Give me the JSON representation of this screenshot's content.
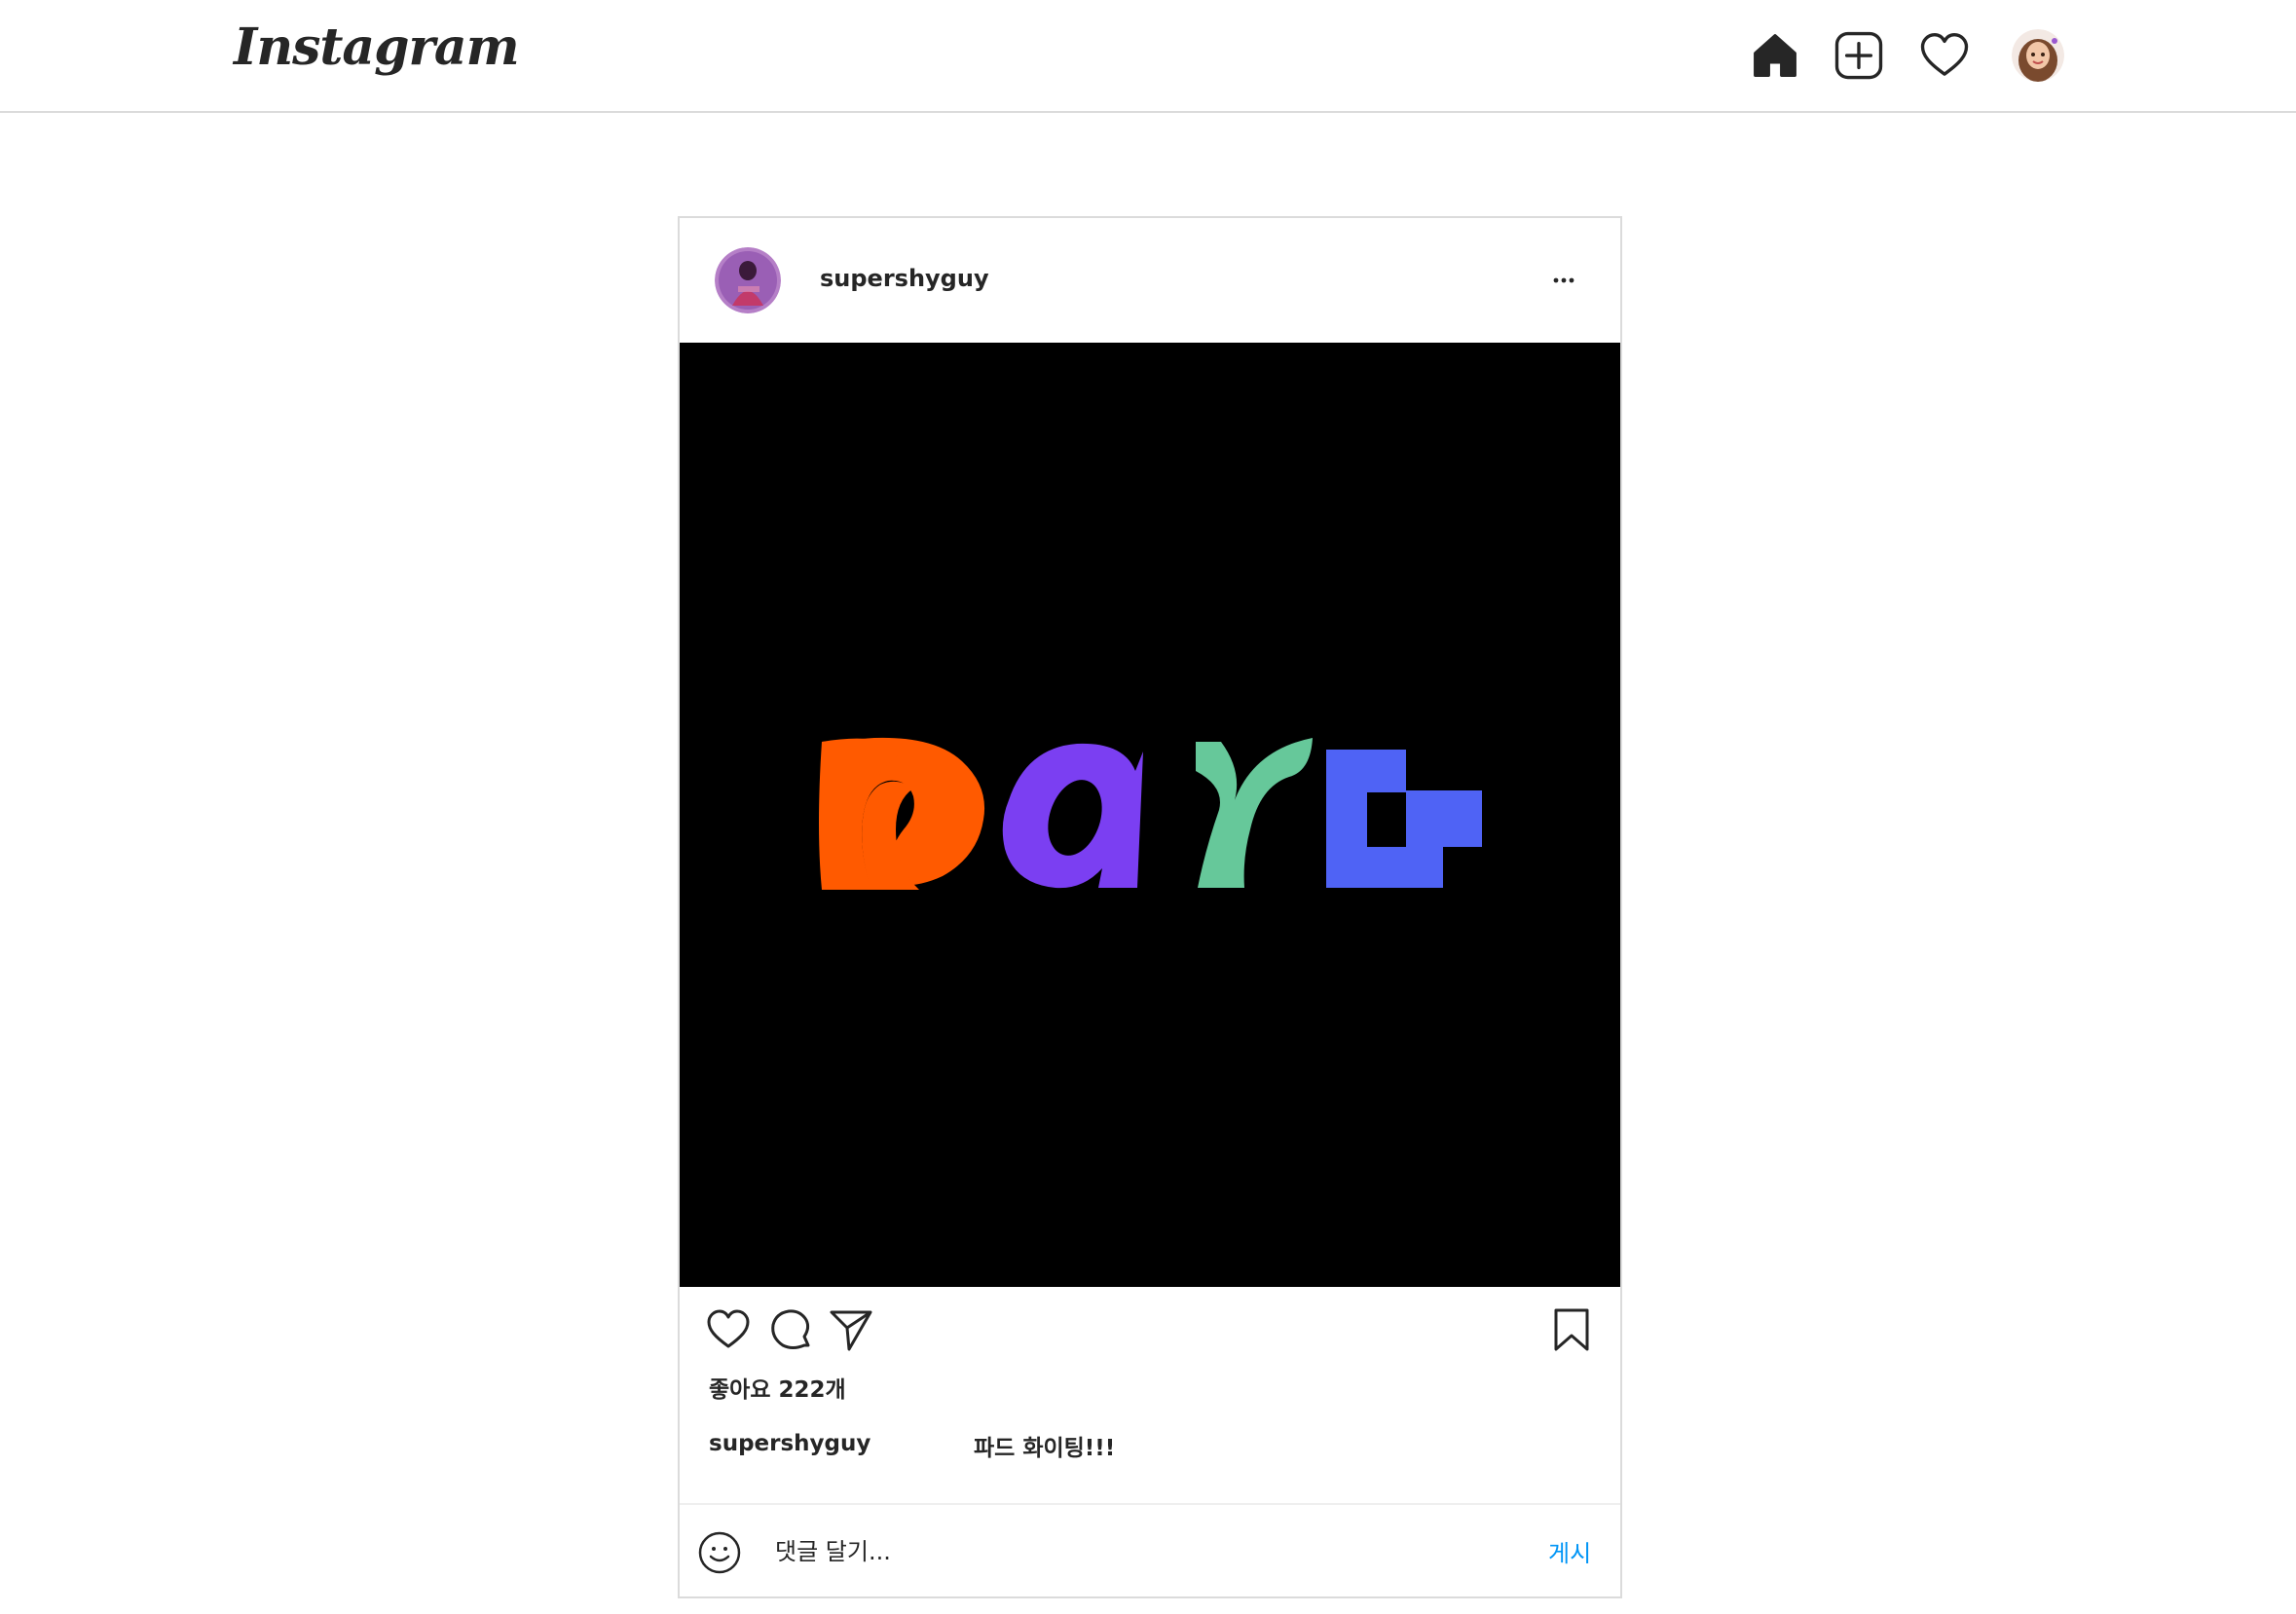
{
  "app": {
    "logo_text": "Instagram"
  },
  "nav": {
    "icons": [
      "home-icon",
      "new-post-icon",
      "activity-heart-icon",
      "profile-avatar"
    ]
  },
  "post": {
    "username": "supershyguy",
    "more_icon": "more-options-icon",
    "image": {
      "background": "#000000",
      "letters": [
        {
          "shape": "p",
          "color": "#ff5a00"
        },
        {
          "shape": "a",
          "color": "#7b3ff2"
        },
        {
          "shape": "r",
          "color": "#66c89a"
        },
        {
          "shape": "d",
          "color": "#4f63f5"
        }
      ]
    },
    "likes_text": "좋아요 222개",
    "caption": {
      "username": "supershyguy",
      "text": "파드 화이팅!!!"
    },
    "comment": {
      "placeholder": "댓글 달기...",
      "post_label": "게시"
    }
  },
  "colors": {
    "accent": "#0095f6",
    "border": "#dbdbdb",
    "text": "#262626"
  }
}
